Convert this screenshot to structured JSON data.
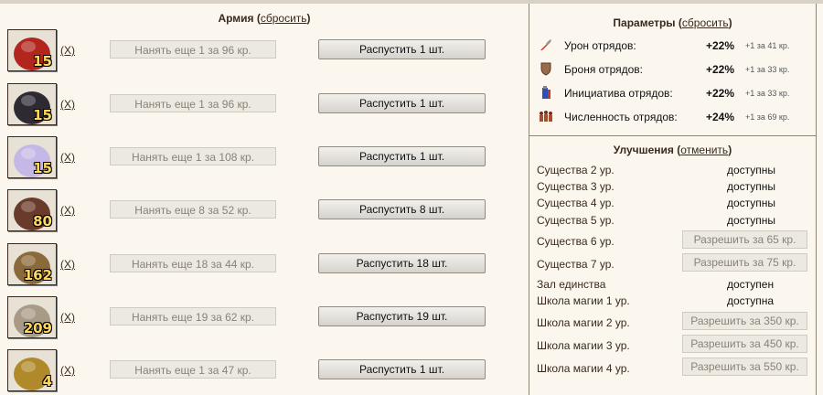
{
  "army": {
    "title": "Армия",
    "reset_label": "сбросить",
    "units": [
      {
        "count": "15",
        "x_label": "(X)",
        "hire": "Нанять еще 1 за 96 кр.",
        "dismiss": "Распустить 1 шт.",
        "color": "#b3261e",
        "icon": "red-creature-icon"
      },
      {
        "count": "15",
        "x_label": "(X)",
        "hire": "Нанять еще 1 за 96 кр.",
        "dismiss": "Распустить 1 шт.",
        "color": "#2e2a33",
        "icon": "dark-horse-icon"
      },
      {
        "count": "15",
        "x_label": "(X)",
        "hire": "Нанять еще 1 за 108 кр.",
        "dismiss": "Распустить 1 шт.",
        "color": "#c6b8e6",
        "icon": "unicorn-icon"
      },
      {
        "count": "80",
        "x_label": "(X)",
        "hire": "Нанять еще 8 за 52 кр.",
        "dismiss": "Распустить 8 шт.",
        "color": "#6a3a2a",
        "icon": "horned-demon-icon"
      },
      {
        "count": "162",
        "x_label": "(X)",
        "hire": "Нанять еще 18 за 44 кр.",
        "dismiss": "Распустить 18 шт.",
        "color": "#8a6a3a",
        "icon": "dwarf-warrior-icon"
      },
      {
        "count": "209",
        "x_label": "(X)",
        "hire": "Нанять еще 19 за 62 кр.",
        "dismiss": "Распустить 19 шт.",
        "color": "#a89a86",
        "icon": "bearded-warrior-icon"
      },
      {
        "count": "4",
        "x_label": "(X)",
        "hire": "Нанять еще 1 за 47 кр.",
        "dismiss": "Распустить 1 шт.",
        "color": "#b08a2a",
        "icon": "armored-knight-icon"
      }
    ]
  },
  "params": {
    "title": "Параметры",
    "reset_label": "сбросить",
    "items": [
      {
        "label": "Урон отрядов:",
        "value": "+22%",
        "extra": "+1 за 41 кр.",
        "icon": "sword-icon"
      },
      {
        "label": "Броня отрядов:",
        "value": "+22%",
        "extra": "+1 за 33 кр.",
        "icon": "shield-icon"
      },
      {
        "label": "Инициатива отрядов:",
        "value": "+22%",
        "extra": "+1 за 33 кр.",
        "icon": "potion-icon"
      },
      {
        "label": "Численность отрядов:",
        "value": "+24%",
        "extra": "+1 за 69 кр.",
        "icon": "troops-icon"
      }
    ]
  },
  "upgrades": {
    "title": "Улучшения",
    "cancel_label": "отменить",
    "items": [
      {
        "label": "Существа 2 ур.",
        "status": "доступны"
      },
      {
        "label": "Существа 3 ур.",
        "status": "доступны"
      },
      {
        "label": "Существа 4 ур.",
        "status": "доступны"
      },
      {
        "label": "Существа 5 ур.",
        "status": "доступны"
      },
      {
        "label": "Существа 6 ур.",
        "button": "Разрешить за 65 кр."
      },
      {
        "label": "Существа 7 ур.",
        "button": "Разрешить за 75 кр."
      },
      {
        "label": "Зал единства",
        "status": "доступен"
      },
      {
        "label": "Школа магии 1 ур.",
        "status": "доступна"
      },
      {
        "label": "Школа магии 2 ур.",
        "button": "Разрешить за 350 кр."
      },
      {
        "label": "Школа магии 3 ур.",
        "button": "Разрешить за 450 кр."
      },
      {
        "label": "Школа магии 4 ур.",
        "button": "Разрешить за 550 кр."
      }
    ]
  }
}
